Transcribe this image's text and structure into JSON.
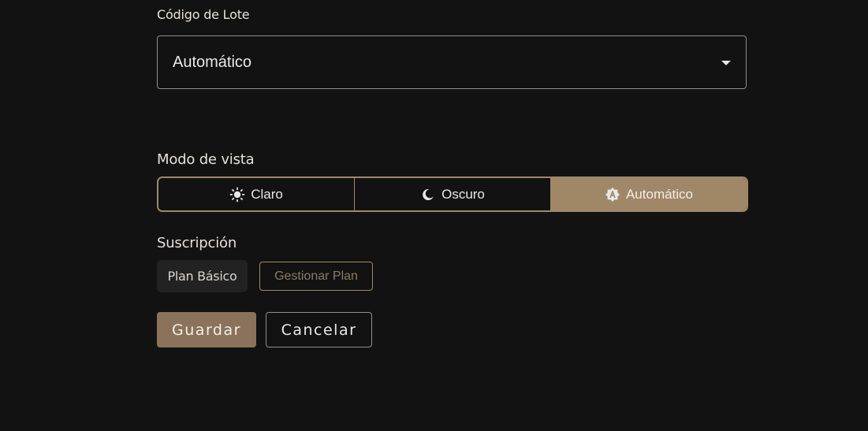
{
  "lote": {
    "label": "Código de Lote",
    "selected_value": "Automático"
  },
  "view_mode": {
    "label": "Modo de vista",
    "options": [
      {
        "label": "Claro",
        "icon": "sun-icon"
      },
      {
        "label": "Oscuro",
        "icon": "moon-icon"
      },
      {
        "label": "Automático",
        "icon": "auto-brightness-icon"
      }
    ],
    "selected": "Automático"
  },
  "subscription": {
    "label": "Suscripción",
    "plan": "Plan Básico",
    "manage_label": "Gestionar Plan"
  },
  "actions": {
    "save_label": "Guardar",
    "cancel_label": "Cancelar"
  },
  "colors": {
    "background": "#121212",
    "accent": "#a08767",
    "save_button": "#8a735a"
  }
}
